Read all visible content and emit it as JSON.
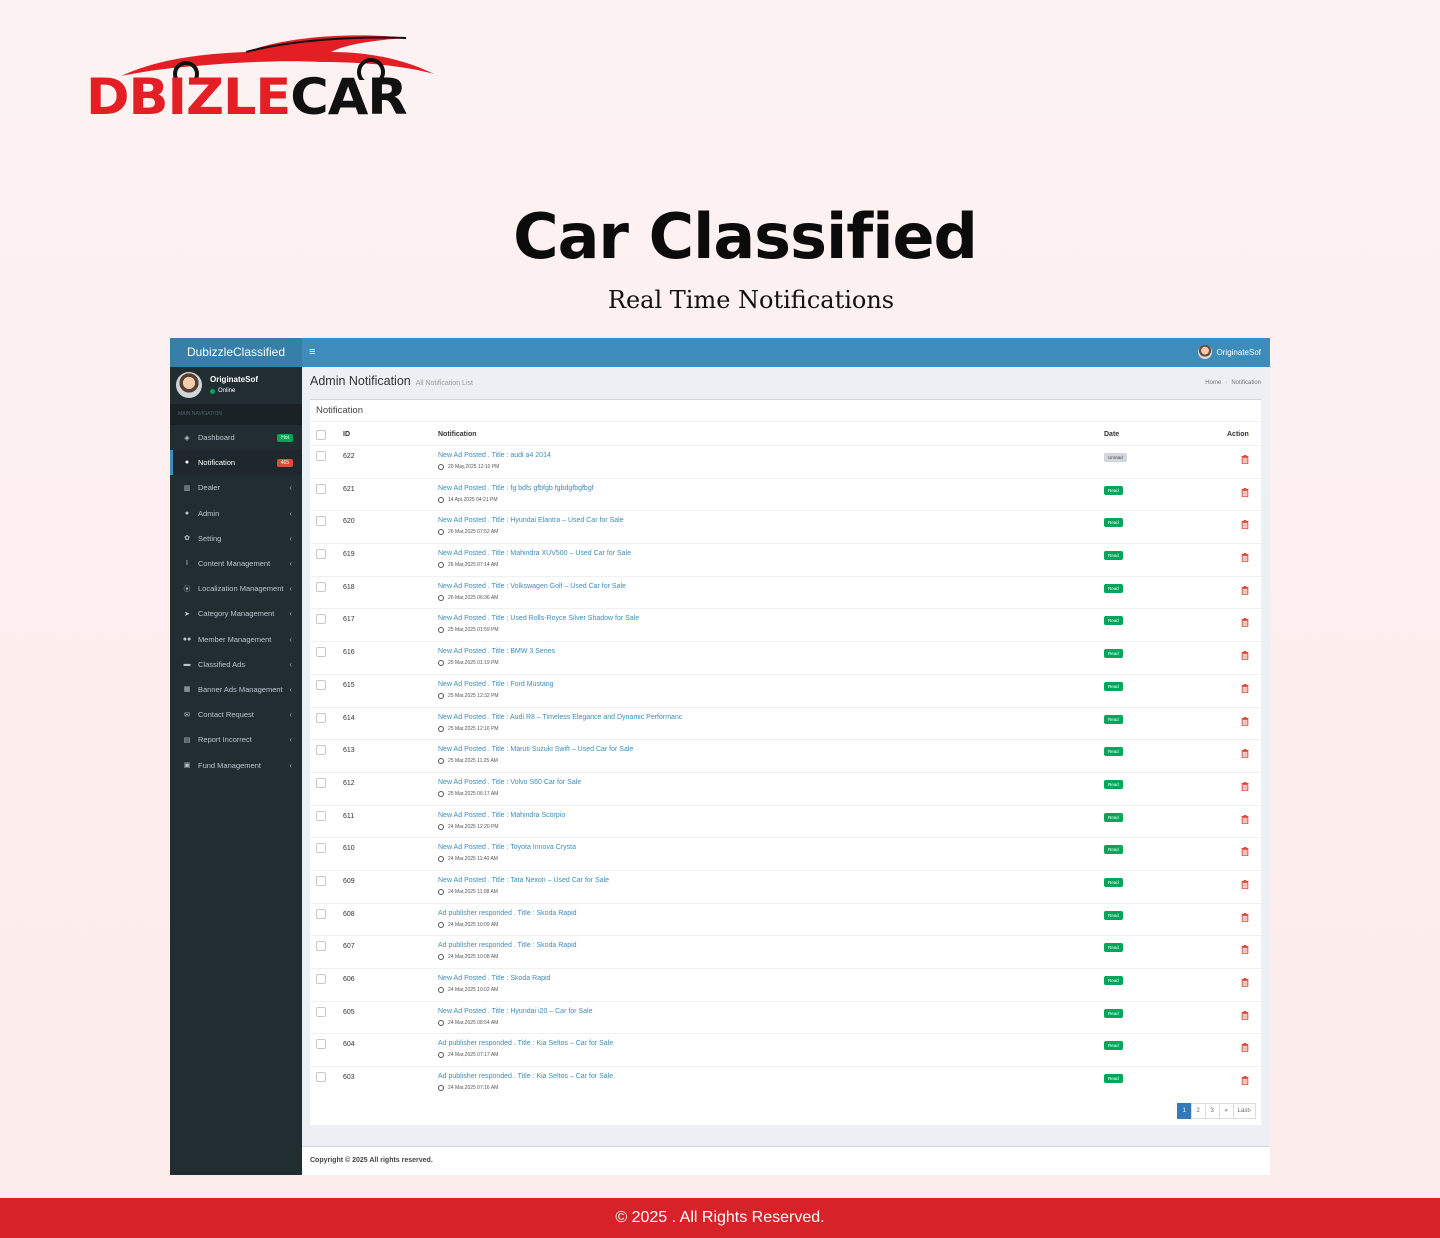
{
  "brand_logo": {
    "part1": "DBIZLE",
    "part2": "CAR",
    "colors": {
      "red": "#e31e24",
      "dark": "#111111"
    }
  },
  "hero": {
    "title": "Car Classified",
    "subtitle": "Real Time Notifications"
  },
  "admin": {
    "app_name": "DubizzleClassified",
    "menu_toggle_icon": "hamburger-icon",
    "top_user": "OriginateSof",
    "user_panel": {
      "name": "OriginateSof",
      "status": "Online"
    },
    "nav_header": "MAIN NAVIGATION",
    "menu": [
      {
        "label": "Dashboard",
        "icon": "dashboard-icon",
        "badge": "Hot",
        "badge_color": "#00a65a"
      },
      {
        "label": "Notification",
        "icon": "bell-icon",
        "badge": "465",
        "badge_color": "#dd4b39",
        "active": true
      },
      {
        "label": "Dealer",
        "icon": "chart-icon"
      },
      {
        "label": "Admin",
        "icon": "user-icon"
      },
      {
        "label": "Setting",
        "icon": "gear-icon"
      },
      {
        "label": "Content Management",
        "icon": "text-cursor-icon"
      },
      {
        "label": "Localization Management",
        "icon": "map-marker-icon"
      },
      {
        "label": "Category Management",
        "icon": "pointer-icon"
      },
      {
        "label": "Member Management",
        "icon": "users-icon"
      },
      {
        "label": "Classified Ads",
        "icon": "briefcase-icon"
      },
      {
        "label": "Banner Ads Management",
        "icon": "newspaper-icon"
      },
      {
        "label": "Contact Request",
        "icon": "envelope-icon"
      },
      {
        "label": "Report Incorrect",
        "icon": "file-icon"
      },
      {
        "label": "Fund Management",
        "icon": "money-icon"
      }
    ],
    "content_header": {
      "title": "Admin Notification",
      "subtitle": "All Notification List"
    },
    "breadcrumb": [
      "Home",
      "Notification"
    ],
    "box_title": "Notification",
    "table_headers": {
      "id": "ID",
      "notification": "Notification",
      "date": "Date",
      "action": "Action"
    },
    "rows": [
      {
        "id": "622",
        "text": "New Ad Posted . Title : audi a4 2014",
        "time": "20 May,2025 12:10 PM",
        "status": "Unread"
      },
      {
        "id": "621",
        "text": "New Ad Posted . Title : fg bdfs gfbfgb fgbdgfbgfbgf",
        "time": "14 Apr,2025 04:21 PM",
        "status": "Read"
      },
      {
        "id": "620",
        "text": "New Ad Posted . Title : Hyundai Elantra – Used Car for Sale",
        "time": "26 Mar,2025 07:52 AM",
        "status": "Read"
      },
      {
        "id": "619",
        "text": "New Ad Posted . Title : Mahindra XUV500 – Used Car for Sale",
        "time": "26 Mar,2025 07:14 AM",
        "status": "Read"
      },
      {
        "id": "618",
        "text": "New Ad Posted . Title : Volkswagen Golf – Used Car for Sale",
        "time": "26 Mar,2025 06:36 AM",
        "status": "Read"
      },
      {
        "id": "617",
        "text": "New Ad Posted . Title : Used Rolls-Royce Silver Shadow for Sale",
        "time": "25 Mar,2025 01:59 PM",
        "status": "Read"
      },
      {
        "id": "616",
        "text": "New Ad Posted . Title : BMW 3 Series",
        "time": "25 Mar,2025 01:19 PM",
        "status": "Read"
      },
      {
        "id": "615",
        "text": "New Ad Posted . Title : Ford Mustang",
        "time": "25 Mar,2025 12:32 PM",
        "status": "Read"
      },
      {
        "id": "614",
        "text": "New Ad Posted . Title : Audi R8 – Timeless Elegance and Dynamic Performanc",
        "time": "25 Mar,2025 12:16 PM",
        "status": "Read"
      },
      {
        "id": "613",
        "text": "New Ad Posted . Title : Maruti Suzuki Swift – Used Car for Sale",
        "time": "25 Mar,2025 11:25 AM",
        "status": "Read"
      },
      {
        "id": "612",
        "text": "New Ad Posted . Title : Volvo S60 Car for Sale",
        "time": "25 Mar,2025 06:17 AM",
        "status": "Read"
      },
      {
        "id": "611",
        "text": "New Ad Posted . Title : Mahindra Scorpio",
        "time": "24 Mar,2025 12:20 PM",
        "status": "Read"
      },
      {
        "id": "610",
        "text": "New Ad Posted . Title : Toyota Innova Crysta",
        "time": "24 Mar,2025 11:40 AM",
        "status": "Read"
      },
      {
        "id": "609",
        "text": "New Ad Posted . Title : Tata Nexon – Used Car for Sale",
        "time": "24 Mar,2025 11:08 AM",
        "status": "Read"
      },
      {
        "id": "608",
        "text": "Ad publisher responded . Title : Skoda Rapid",
        "time": "24 Mar,2025 10:09 AM",
        "status": "Read"
      },
      {
        "id": "607",
        "text": "Ad publisher responded . Title : Skoda Rapid",
        "time": "24 Mar,2025 10:08 AM",
        "status": "Read"
      },
      {
        "id": "606",
        "text": "New Ad Posted . Title : Skoda Rapid",
        "time": "24 Mar,2025 10:02 AM",
        "status": "Read"
      },
      {
        "id": "605",
        "text": "New Ad Posted . Title : Hyundai i20 – Car for Sale",
        "time": "24 Mar,2025 08:54 AM",
        "status": "Read"
      },
      {
        "id": "604",
        "text": "Ad publisher responded . Title : Kia Seltos – Car for Sale",
        "time": "24 Mar,2025 07:17 AM",
        "status": "Read"
      },
      {
        "id": "603",
        "text": "Ad publisher responded . Title : Kia Seltos – Car for Sale",
        "time": "24 Mar,2025 07:16 AM",
        "status": "Read"
      }
    ],
    "pagination": [
      "1",
      "2",
      "3",
      "»",
      "Last›"
    ],
    "current_page": "1",
    "footer": "Copyright © 2025 All rights reserved."
  },
  "page_footer": "© 2025 . All Rights Reserved."
}
